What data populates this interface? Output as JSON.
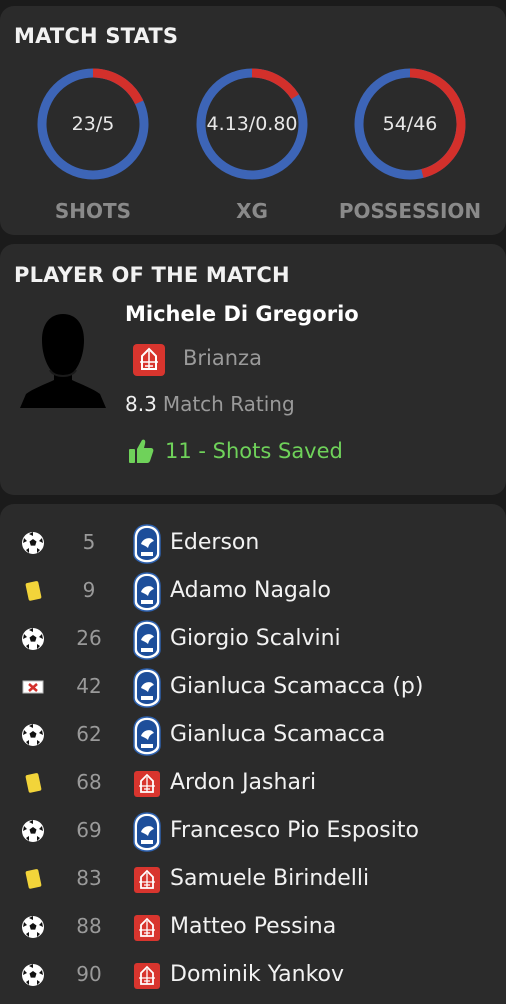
{
  "match_stats": {
    "title": "MATCH STATS",
    "gauges": [
      {
        "value": "23/5",
        "label": "SHOTS",
        "home_share": 0.82
      },
      {
        "value": "4.13/0.80",
        "label": "XG",
        "home_share": 0.84
      },
      {
        "value": "54/46",
        "label": "POSSESSION",
        "home_share": 0.54
      }
    ],
    "colors": {
      "home": "#3d65b7",
      "away": "#d3302b"
    }
  },
  "potm": {
    "title": "PLAYER OF THE MATCH",
    "name": "Michele Di Gregorio",
    "club": "Brianza",
    "rating": "8.3",
    "rating_label": "Match Rating",
    "highlight": "11 - Shots Saved"
  },
  "events": [
    {
      "type": "goal-icon",
      "minute": "5",
      "team": "atalanta",
      "player": "Ederson"
    },
    {
      "type": "yellow-card-icon",
      "minute": "9",
      "team": "atalanta",
      "player": "Adamo Nagalo"
    },
    {
      "type": "goal-icon",
      "minute": "26",
      "team": "atalanta",
      "player": "Giorgio Scalvini"
    },
    {
      "type": "missed-penalty-icon",
      "minute": "42",
      "team": "atalanta",
      "player": "Gianluca Scamacca (p)"
    },
    {
      "type": "goal-icon",
      "minute": "62",
      "team": "atalanta",
      "player": "Gianluca Scamacca"
    },
    {
      "type": "yellow-card-icon",
      "minute": "68",
      "team": "brianza",
      "player": "Ardon Jashari"
    },
    {
      "type": "goal-icon",
      "minute": "69",
      "team": "atalanta",
      "player": "Francesco Pio Esposito"
    },
    {
      "type": "yellow-card-icon",
      "minute": "83",
      "team": "brianza",
      "player": "Samuele Birindelli"
    },
    {
      "type": "goal-icon",
      "minute": "88",
      "team": "brianza",
      "player": "Matteo Pessina"
    },
    {
      "type": "goal-icon",
      "minute": "90",
      "team": "brianza",
      "player": "Dominik Yankov"
    }
  ]
}
